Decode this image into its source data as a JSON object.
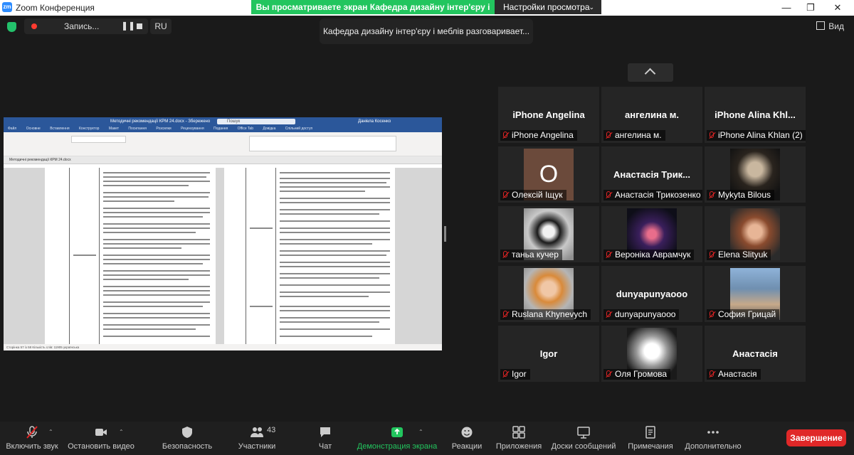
{
  "window": {
    "title": "Zoom Конференция",
    "logo_text": "zm",
    "share_banner": "Вы просматриваете экран Кафедра дизайну інтер'єру і ме...",
    "view_options": "Настройки просмотра",
    "controls": {
      "minimize": "—",
      "maximize": "❐",
      "close": "✕"
    }
  },
  "topbar": {
    "recording_label": "Запись...",
    "pause_symbol": "❚❚",
    "language": "RU",
    "view_label": "Вид"
  },
  "speaker_toast": "Кафедра дизайну інтер'єру і меблів разговаривает...",
  "shared_screen": {
    "word_title": "Методичні рекомендації КРМ 24.docx - Збережено",
    "search_placeholder": "Пошук",
    "user_name": "Даніела Косенко",
    "tabs": [
      "Файл",
      "Основне",
      "Вставлення",
      "Конструктор",
      "Макет",
      "Посилання",
      "Розсилки",
      "Рецензування",
      "Подання",
      "Office Tab",
      "Довідка",
      "Спільний доступ"
    ],
    "doc_tab": "Методичні рекомендації КРМ 24.docx",
    "status": "Сторінка 57 із 58   Кількість слів: 11905   українська"
  },
  "participants": [
    {
      "display": "iPhone Angelina",
      "name": "iPhone Angelina",
      "type": "text"
    },
    {
      "display": "ангелина м.",
      "name": "ангелина м.",
      "type": "text"
    },
    {
      "display": "iPhone Alina Khl...",
      "name": "iPhone Alina Khlan (2)",
      "type": "text"
    },
    {
      "display": "O",
      "name": "Олексій Іщук",
      "type": "avatar-letter",
      "color": "#6b4a3b"
    },
    {
      "display": "Анастасія Трик...",
      "name": "Анастасія Трикозенко",
      "type": "text"
    },
    {
      "display": "",
      "name": "Mykyta Bilous",
      "type": "photo"
    },
    {
      "display": "",
      "name": "таньа кучер",
      "type": "photo"
    },
    {
      "display": "",
      "name": "Вероніка Аврамчук",
      "type": "photo"
    },
    {
      "display": "",
      "name": "Elena Slityuk",
      "type": "photo"
    },
    {
      "display": "",
      "name": "Ruslana Khynevych",
      "type": "photo"
    },
    {
      "display": "dunyapunyaooo",
      "name": "dunyapunyaooo",
      "type": "text"
    },
    {
      "display": "",
      "name": "София Грицай",
      "type": "photo"
    },
    {
      "display": "Igor",
      "name": "Igor",
      "type": "text"
    },
    {
      "display": "",
      "name": "Оля Громова",
      "type": "photo"
    },
    {
      "display": "Анастасія",
      "name": "Анастасія",
      "type": "text"
    }
  ],
  "toolbar": {
    "unmute": "Включить звук",
    "stop_video": "Остановить видео",
    "security": "Безопасность",
    "participants": "Участники",
    "participants_count": "43",
    "chat": "Чат",
    "share_screen": "Демонстрация экрана",
    "reactions": "Реакции",
    "apps": "Приложения",
    "whiteboards": "Доски сообщений",
    "notes": "Примечания",
    "more": "Дополнительно",
    "end": "Завершение"
  },
  "colors": {
    "accent": "#2D8CFF",
    "share_green": "#22c55e",
    "end_red": "#e02828",
    "muted_red": "#e02424"
  }
}
